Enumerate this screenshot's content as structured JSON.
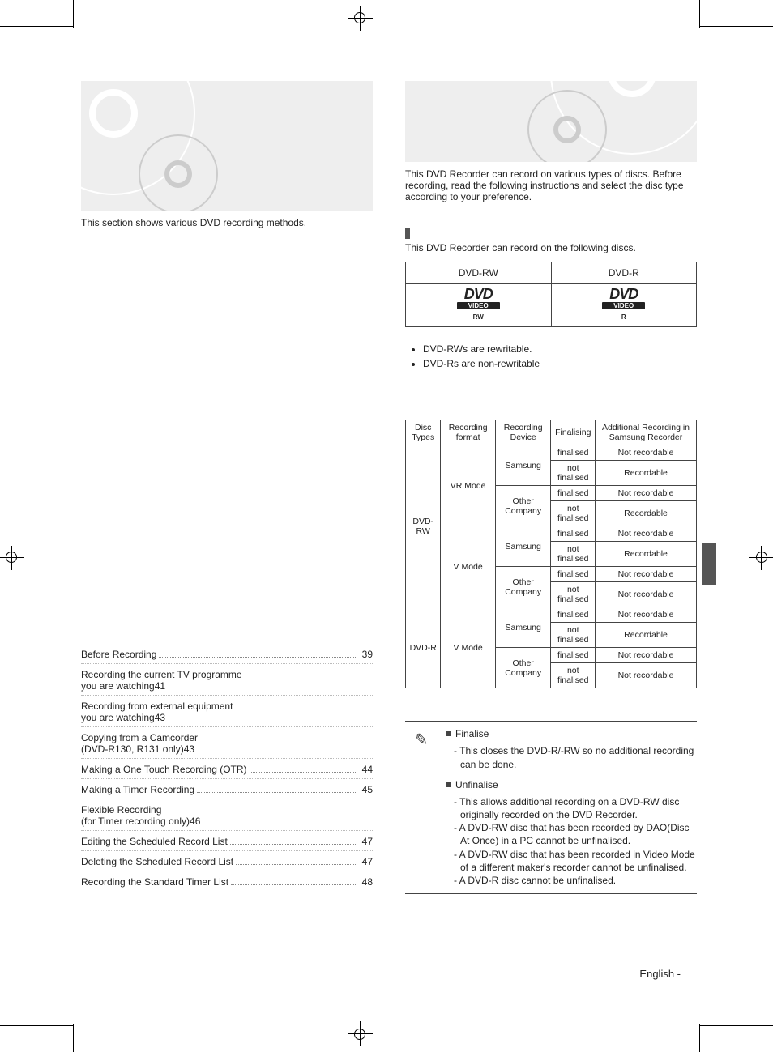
{
  "left": {
    "intro": "This section shows various DVD recording methods.",
    "toc": [
      {
        "label": "Before Recording",
        "page": "39"
      },
      {
        "label": "Recording the current TV programme",
        "label2": "you are watching",
        "page": "41"
      },
      {
        "label": "Recording from external equipment",
        "label2": "you are watching",
        "page": "43"
      },
      {
        "label": "Copying from a Camcorder",
        "label2": "(DVD-R130, R131 only)",
        "page": "43"
      },
      {
        "label": "Making a One Touch Recording (OTR)",
        "page": "44"
      },
      {
        "label": "Making a Timer Recording",
        "page": "45"
      },
      {
        "label": "Flexible Recording",
        "label2": "(for Timer recording only)",
        "page": "46"
      },
      {
        "label": "Editing the Scheduled Record List",
        "page": "47"
      },
      {
        "label": "Deleting the Scheduled Record List",
        "page": "47"
      },
      {
        "label": "Recording the Standard Timer List",
        "page": "48"
      }
    ]
  },
  "right": {
    "intro": "This DVD Recorder can record on various types of discs. Before recording, read the following instructions and select the disc type according to your preference.",
    "section_lead": "This DVD Recorder can record on the following discs.",
    "disc_labels": {
      "rw": "DVD-RW",
      "r": "DVD-R",
      "logo": "DVD",
      "sub": "VIDEO",
      "rw_tiny": "RW",
      "r_tiny": "R"
    },
    "bullets": [
      "DVD-RWs are rewritable.",
      "DVD-Rs are non-rewritable"
    ],
    "compat_headers": {
      "types": "Disc Types",
      "format": "Recording format",
      "device": "Recording Device",
      "final": "Finalising",
      "add": "Additional Recording in Samsung Recorder"
    },
    "compat_rows": {
      "rw": "DVD-RW",
      "r": "DVD-R",
      "vr": "VR Mode",
      "v": "V Mode",
      "sam": "Samsung",
      "other": "Other Company",
      "fin": "finalised",
      "nfin": "not finalised",
      "nrec": "Not recordable",
      "rec": "Recordable"
    },
    "notes": {
      "t1": "Finalise",
      "t1a": "- This closes the DVD-R/-RW so no additional recording can be done.",
      "t2": "Unfinalise",
      "t2a": "- This allows additional recording on a DVD-RW disc originally recorded on the DVD Recorder.",
      "t2b": "- A DVD-RW disc that has been recorded by DAO(Disc At Once) in a PC cannot be unfinalised.",
      "t2c": "- A DVD-RW disc that has been recorded in Video Mode of a different maker's recorder cannot be unfinalised.",
      "t2d": "- A DVD-R disc cannot be unfinalised."
    }
  },
  "footer": "English -"
}
